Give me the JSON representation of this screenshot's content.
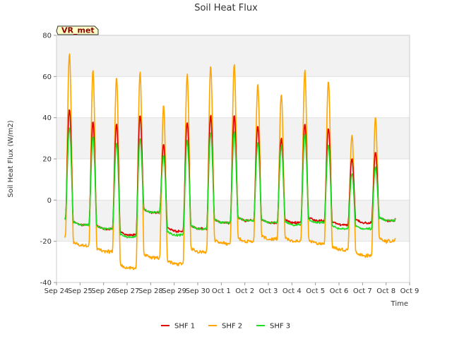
{
  "chart_data": {
    "type": "line",
    "title": "Soil Heat Flux",
    "xlabel": "Time",
    "ylabel": "Soil Heat Flux (W/m2)",
    "badge": "VR_met",
    "ylim": [
      -40,
      80
    ],
    "xlim": [
      0,
      15
    ],
    "yticks": [
      -40,
      -20,
      0,
      20,
      40,
      60,
      80
    ],
    "x_tick_labels": [
      "Sep 24",
      "Sep 25",
      "Sep 26",
      "Sep 27",
      "Sep 28",
      "Sep 29",
      "Sep 30",
      "Oct 1",
      "Oct 2",
      "Oct 3",
      "Oct 4",
      "Oct 5",
      "Oct 6",
      "Oct 7",
      "Oct 8",
      "Oct 9"
    ],
    "grid": "horizontal bands",
    "legend_position": "bottom-center",
    "x_days_since": "Sep 24",
    "data_range": [
      0.35,
      14.4
    ],
    "series": [
      {
        "name": "SHF 1",
        "color": "#e00000",
        "peaks": [
          44,
          38,
          37,
          41,
          27,
          38,
          41,
          41,
          36,
          30,
          37,
          35,
          20,
          23
        ],
        "troughs": [
          -9,
          -12,
          -14,
          -17,
          -6,
          -15,
          -14,
          -11,
          -10,
          -11,
          -11,
          -10,
          -12,
          -11,
          -10
        ]
      },
      {
        "name": "SHF 2",
        "color": "#ffa500",
        "peaks": [
          71,
          63,
          60,
          62,
          46,
          61,
          65,
          66,
          56,
          51,
          63,
          58,
          32,
          40
        ],
        "troughs": [
          -18,
          -22,
          -25,
          -33,
          -28,
          -31,
          -25,
          -21,
          -20,
          -19,
          -20,
          -21,
          -24,
          -27,
          -20
        ]
      },
      {
        "name": "SHF 3",
        "color": "#22dd22",
        "peaks": [
          35,
          31,
          28,
          30,
          22,
          29,
          33,
          33,
          28,
          26,
          32,
          27,
          13,
          16
        ],
        "troughs": [
          -9,
          -12,
          -14,
          -18,
          -6,
          -17,
          -14,
          -11,
          -10,
          -11,
          -12,
          -11,
          -14,
          -14,
          -10
        ]
      }
    ]
  }
}
